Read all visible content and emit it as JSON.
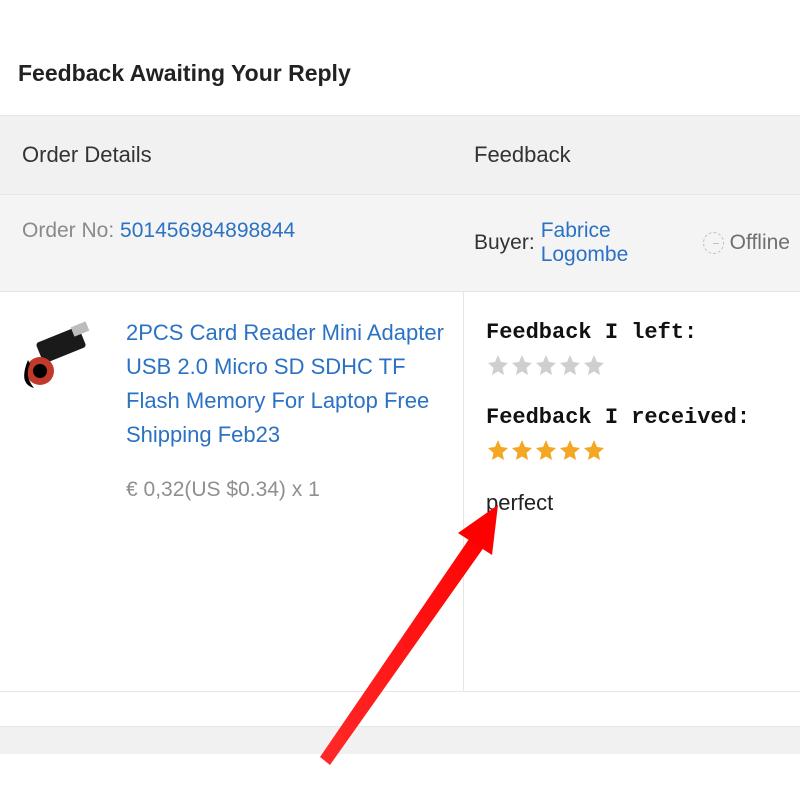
{
  "page": {
    "title": "Feedback Awaiting Your Reply"
  },
  "columns": {
    "order_details": "Order Details",
    "feedback": "Feedback"
  },
  "order": {
    "order_no_label": "Order No: ",
    "order_no": "501456984898844",
    "buyer_label": "Buyer: ",
    "buyer_name": "Fabrice Logombe",
    "status": "Offline"
  },
  "product": {
    "title": "2PCS Card Reader Mini Adapter USB 2.0 Micro SD SDHC TF Flash Memory For Laptop Free Shipping Feb23",
    "price_line": "€ 0,32(US $0.34) x 1"
  },
  "feedback": {
    "left_label": "Feedback I left:",
    "left_stars": 0,
    "received_label": "Feedback I received:",
    "received_stars": 5,
    "received_text": "perfect"
  }
}
